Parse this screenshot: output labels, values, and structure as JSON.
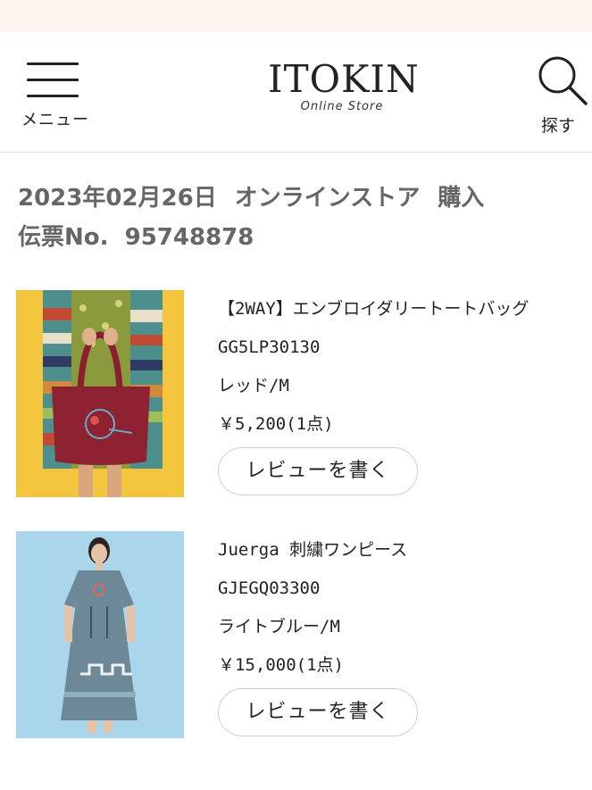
{
  "header": {
    "menu_label": "メニュー",
    "logo_main": "ITOKIN",
    "logo_sub": "Online Store",
    "search_label": "探す",
    "menu_icon": "hamburger-icon",
    "search_icon": "search-icon"
  },
  "order": {
    "date": "2023年02月26日",
    "channel": "オンラインストア",
    "status": "購入",
    "slip_label": "伝票No.",
    "slip_number": "95748878"
  },
  "items": [
    {
      "name": "【2WAY】エンブロイダリートートバッグ",
      "code": "GG5LP30130",
      "variant": "レッド/M",
      "price": "￥5,200(1点)",
      "review_label": "レビューを書く"
    },
    {
      "name": "Juerga 刺繍ワンピース",
      "code": "GJEGQ03300",
      "variant": "ライトブルー/M",
      "price": "￥15,000(1点)",
      "review_label": "レビューを書く"
    }
  ],
  "colors": {
    "top_strip": "#fdf4f0",
    "title_gray": "#666666",
    "border": "#e2e2e2"
  }
}
